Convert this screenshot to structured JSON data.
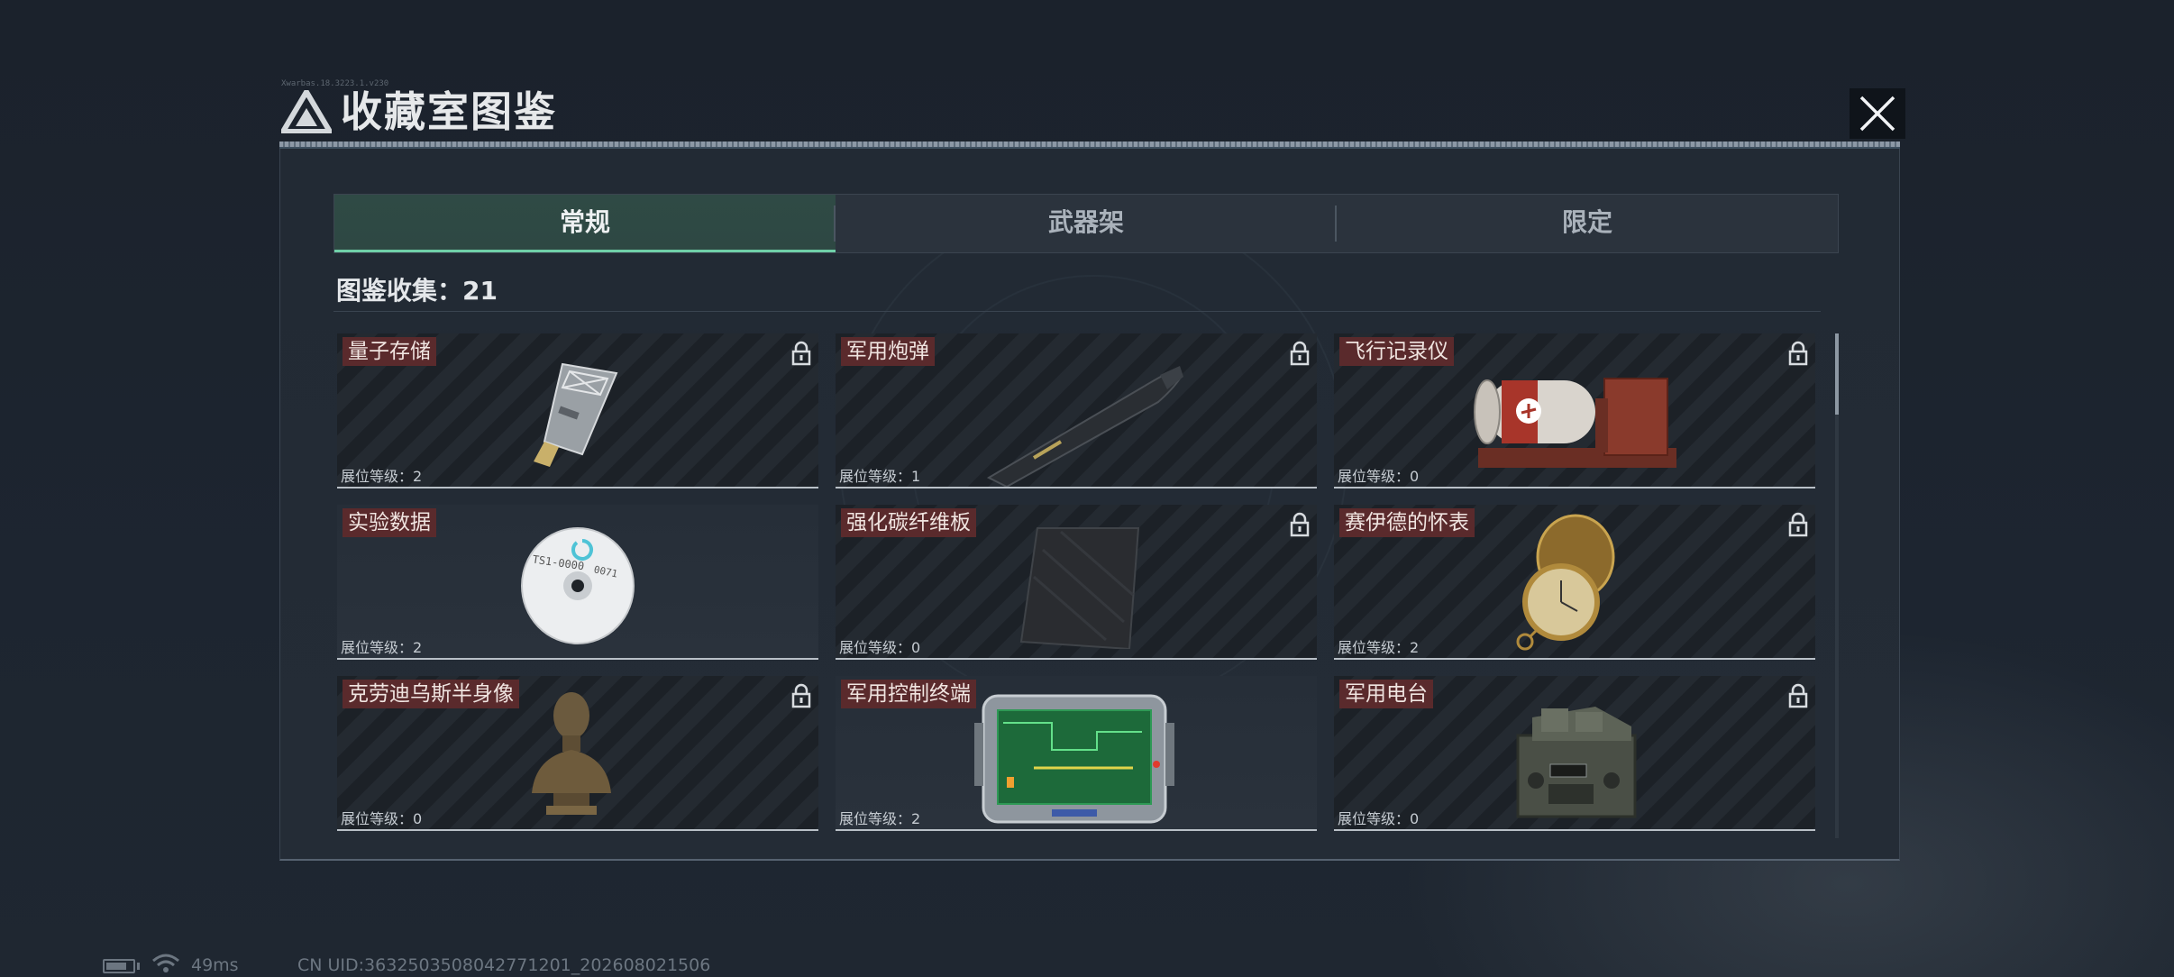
{
  "header": {
    "title": "收藏室图鉴",
    "tiny_code": "Xwarbas.18.3223.1.v230"
  },
  "tabs": [
    {
      "label": "常规",
      "active": true
    },
    {
      "label": "武器架",
      "active": false
    },
    {
      "label": "限定",
      "active": false
    }
  ],
  "collection": {
    "label": "图鉴收集：21"
  },
  "cards": [
    {
      "name": "量子存储",
      "level": "展位等级：2",
      "locked": true,
      "icon": "usb-drive-icon"
    },
    {
      "name": "军用炮弹",
      "level": "展位等级：1",
      "locked": true,
      "icon": "artillery-shell-icon"
    },
    {
      "name": "飞行记录仪",
      "level": "展位等级：0",
      "locked": true,
      "icon": "flight-recorder-icon"
    },
    {
      "name": "实验数据",
      "level": "展位等级：2",
      "locked": false,
      "icon": "data-disc-icon"
    },
    {
      "name": "强化碳纤维板",
      "level": "展位等级：0",
      "locked": true,
      "icon": "carbon-plate-icon"
    },
    {
      "name": "赛伊德的怀表",
      "level": "展位等级：2",
      "locked": true,
      "icon": "pocket-watch-icon"
    },
    {
      "name": "克劳迪乌斯半身像",
      "level": "展位等级：0",
      "locked": true,
      "icon": "bust-statue-icon"
    },
    {
      "name": "军用控制终端",
      "level": "展位等级：2",
      "locked": false,
      "icon": "control-terminal-icon"
    },
    {
      "name": "军用电台",
      "level": "展位等级：0",
      "locked": true,
      "icon": "military-radio-icon"
    }
  ],
  "status": {
    "ping": "49ms",
    "uid": "CN UID:3632503508042771201_202608021506"
  },
  "colors": {
    "accent": "#6fd0a8",
    "name_badge": "#5a2a2c",
    "panel": "#232b35"
  }
}
